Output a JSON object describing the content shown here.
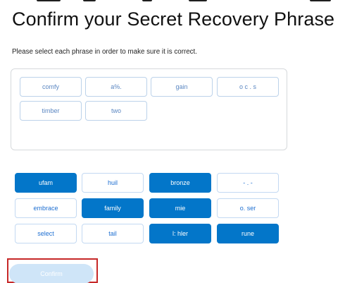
{
  "title": "Confirm your Secret Recovery Phrase",
  "instruction": "Please select each phrase in order to make sure it is correct.",
  "selected_words": [
    "comfy",
    "a%.",
    "gain",
    "o c . s",
    "timber",
    "two"
  ],
  "word_pool": [
    {
      "label": "ufam",
      "active": true
    },
    {
      "label": "huil",
      "active": false
    },
    {
      "label": "bronze",
      "active": true
    },
    {
      "label": "- . -",
      "active": false
    },
    {
      "label": "embrace",
      "active": false
    },
    {
      "label": "family",
      "active": true
    },
    {
      "label": "mie",
      "active": true
    },
    {
      "label": "o. ser",
      "active": false
    },
    {
      "label": "select",
      "active": false
    },
    {
      "label": "tail",
      "active": false
    },
    {
      "label": "l: hler",
      "active": true
    },
    {
      "label": "rune",
      "active": true
    }
  ],
  "confirm_button": {
    "label": "Confirm",
    "state": "disabled"
  },
  "colors": {
    "accent": "#0376c9",
    "selected_text": "#5b87c2",
    "pool_border": "#c3d9f2",
    "confirm_disabled": "#cfe5f8",
    "highlight_frame": "#c62828"
  }
}
